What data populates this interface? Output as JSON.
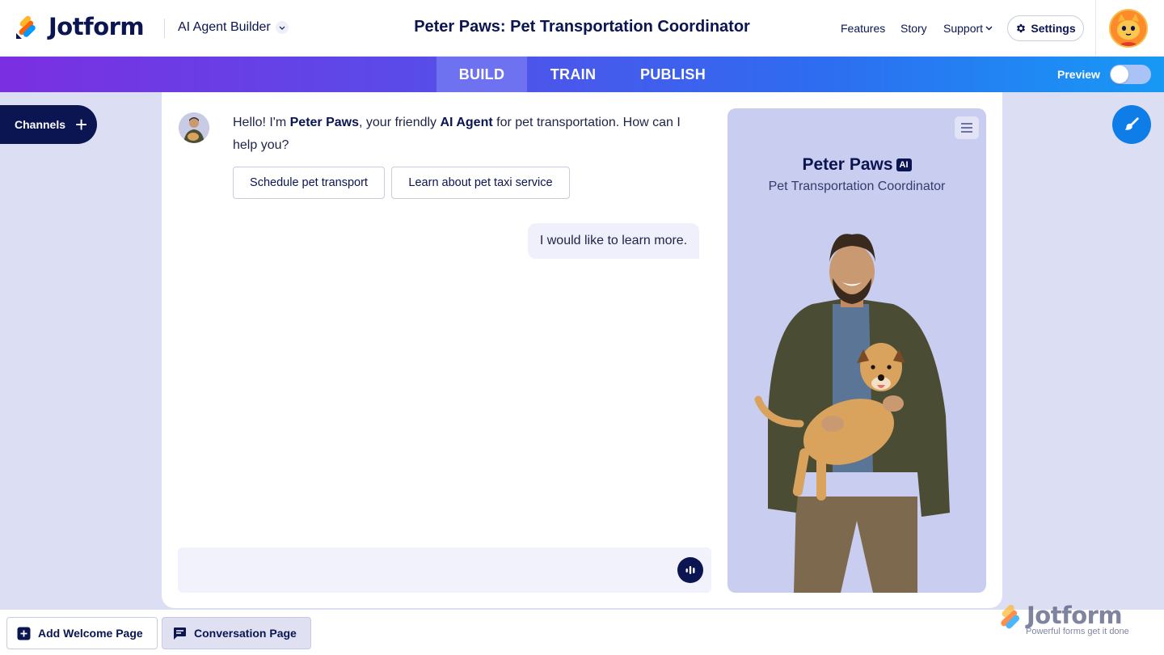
{
  "header": {
    "logo_text": "Jotform",
    "builder_label": "AI Agent Builder",
    "page_title": "Peter Paws: Pet Transportation Coordinator",
    "nav": [
      "Features",
      "Story",
      "Support"
    ],
    "settings_label": "Settings"
  },
  "modebar": {
    "tabs": [
      {
        "label": "BUILD",
        "active": true
      },
      {
        "label": "TRAIN",
        "active": false
      },
      {
        "label": "PUBLISH",
        "active": false
      }
    ],
    "preview_label": "Preview",
    "preview_enabled": false
  },
  "sidebar": {
    "channels_label": "Channels"
  },
  "chat": {
    "bot_greeting": {
      "part1": "Hello! I'm ",
      "name": "Peter Paws",
      "part2": ", your friendly ",
      "role": "AI Agent",
      "part3": " for pet transportation. How can I help you?"
    },
    "quick_replies": [
      "Schedule pet transport",
      "Learn about pet taxi service"
    ],
    "user_message": "I would like to learn more.",
    "input_value": "",
    "input_placeholder": ""
  },
  "agent": {
    "name": "Peter Paws",
    "badge": "AI",
    "role": "Pet Transportation Coordinator"
  },
  "bottombar": {
    "pages": [
      {
        "label": "Add Welcome Page",
        "active": false
      },
      {
        "label": "Conversation Page",
        "active": true
      }
    ],
    "watermark_text": "Jotform",
    "watermark_tagline": "Powerful forms get it done"
  },
  "colors": {
    "navy": "#0a1551",
    "accent_blue": "#0f7de8",
    "panel_lavender": "#c9cdef",
    "background": "#dcdff3"
  }
}
